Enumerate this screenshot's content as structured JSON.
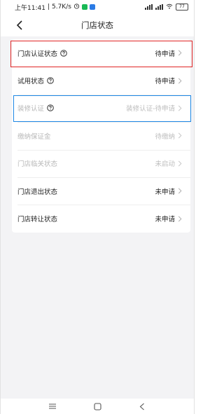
{
  "status_bar": {
    "time": "上午11:41",
    "speed": "5.7K/s",
    "battery": "77"
  },
  "nav": {
    "title": "门店状态"
  },
  "rows": [
    {
      "label": "门店认证状态",
      "value": "待申请",
      "has_help": true,
      "disabled": false
    },
    {
      "label": "试用状态",
      "value": "待申请",
      "has_help": true,
      "disabled": false
    },
    {
      "label": "装修认证",
      "value": "装修认证-待申请",
      "has_help": true,
      "disabled": true
    },
    {
      "label": "缴纳保证金",
      "value": "待缴纳",
      "has_help": false,
      "disabled": true
    },
    {
      "label": "门店临关状态",
      "value": "未启动",
      "has_help": false,
      "disabled": true
    },
    {
      "label": "门店退出状态",
      "value": "未申请",
      "has_help": false,
      "disabled": false
    },
    {
      "label": "门店转让状态",
      "value": "未申请",
      "has_help": false,
      "disabled": false
    }
  ],
  "colors": {
    "highlight_red": "#e02424",
    "highlight_blue": "#1e88e5",
    "app_green": "#19b955",
    "app_blue": "#2b7be5"
  },
  "icons": [
    "back-arrow-icon",
    "help-circle-icon",
    "chevron-right-icon",
    "alarm-icon",
    "signal-icon",
    "wifi-icon",
    "battery-icon",
    "menu-key-icon",
    "home-key-icon",
    "back-key-icon"
  ]
}
